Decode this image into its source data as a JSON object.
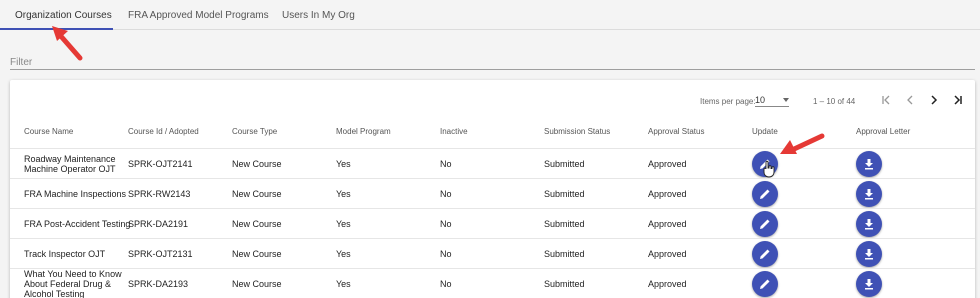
{
  "tabs": [
    {
      "label": "Organization Courses",
      "active": true
    },
    {
      "label": "FRA Approved Model Programs",
      "active": false
    },
    {
      "label": "Users In My Org",
      "active": false
    }
  ],
  "filter": {
    "placeholder": "Filter"
  },
  "paginator": {
    "items_per_page_label": "Items per page:",
    "items_per_page_value": "10",
    "range_label": "1 – 10 of 44"
  },
  "table": {
    "columns": [
      "Course Name",
      "Course Id / Adopted",
      "Course Type",
      "Model Program",
      "Inactive",
      "Submission Status",
      "Approval Status",
      "Update",
      "Approval Letter"
    ],
    "rows": [
      {
        "name": "Roadway Maintenance Machine Operator OJT",
        "id": "SPRK-OJT2141",
        "type": "New Course",
        "model": "Yes",
        "inactive": "No",
        "submission": "Submitted",
        "approval": "Approved"
      },
      {
        "name": "FRA Machine Inspections",
        "id": "SPRK-RW2143",
        "type": "New Course",
        "model": "Yes",
        "inactive": "No",
        "submission": "Submitted",
        "approval": "Approved"
      },
      {
        "name": "FRA Post-Accident Testing",
        "id": "SPRK-DA2191",
        "type": "New Course",
        "model": "Yes",
        "inactive": "No",
        "submission": "Submitted",
        "approval": "Approved"
      },
      {
        "name": "Track Inspector OJT",
        "id": "SPRK-OJT2131",
        "type": "New Course",
        "model": "Yes",
        "inactive": "No",
        "submission": "Submitted",
        "approval": "Approved"
      },
      {
        "name": "What You Need to Know About Federal Drug & Alcohol Testing",
        "id": "SPRK-DA2193",
        "type": "New Course",
        "model": "Yes",
        "inactive": "No",
        "submission": "Submitted",
        "approval": "Approved"
      }
    ]
  },
  "icons": {
    "update": "pencil-icon",
    "approval_letter": "download-icon"
  },
  "colors": {
    "accent": "#3f51b5",
    "annotation_arrow": "#e53935"
  }
}
